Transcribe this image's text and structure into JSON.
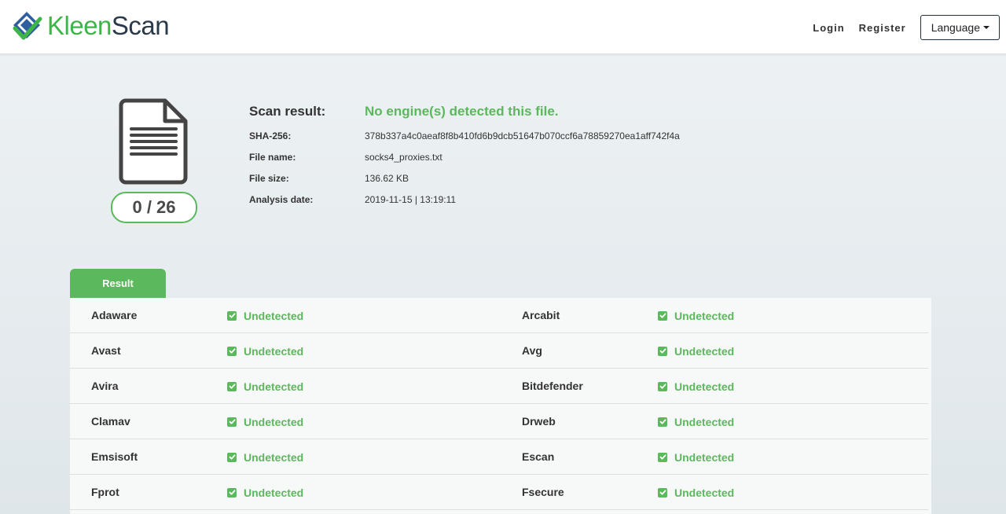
{
  "header": {
    "logo_first": "Kleen",
    "logo_second": "Scan",
    "login": "Login",
    "register": "Register",
    "language": "Language"
  },
  "summary": {
    "score": "0 / 26",
    "scan_result_label": "Scan result:",
    "scan_result_value": "No engine(s) detected this file.",
    "sha_label": "SHA-256:",
    "sha_value": "378b337a4c0aeaf8f8b410fd6b9dcb51647b070ccf6a78859270ea1aff742f4a",
    "file_name_label": "File name:",
    "file_name_value": "socks4_proxies.txt",
    "file_size_label": "File size:",
    "file_size_value": "136.62 KB",
    "date_label": "Analysis date:",
    "date_value": "2019-11-15 | 13:19:11"
  },
  "tab_label": "Result",
  "results": [
    {
      "left_engine": "Adaware",
      "left_status": "Undetected",
      "right_engine": "Arcabit",
      "right_status": "Undetected"
    },
    {
      "left_engine": "Avast",
      "left_status": "Undetected",
      "right_engine": "Avg",
      "right_status": "Undetected"
    },
    {
      "left_engine": "Avira",
      "left_status": "Undetected",
      "right_engine": "Bitdefender",
      "right_status": "Undetected"
    },
    {
      "left_engine": "Clamav",
      "left_status": "Undetected",
      "right_engine": "Drweb",
      "right_status": "Undetected"
    },
    {
      "left_engine": "Emsisoft",
      "left_status": "Undetected",
      "right_engine": "Escan",
      "right_status": "Undetected"
    },
    {
      "left_engine": "Fprot",
      "left_status": "Undetected",
      "right_engine": "Fsecure",
      "right_status": "Undetected"
    }
  ],
  "colors": {
    "accent_green": "#5cb85c",
    "logo_green": "#3eb549",
    "logo_dark": "#2b3a4a"
  }
}
